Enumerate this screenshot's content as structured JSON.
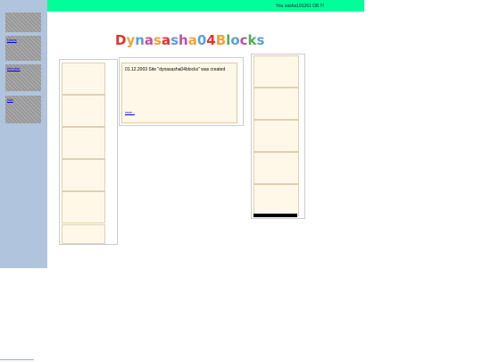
{
  "topbar": {
    "info": "You sasha191261 ОБ !!!"
  },
  "logo": {
    "text": "Dynasasha04Blocks",
    "letter_colors": [
      "#e0332e",
      "#f2a33a",
      "#5aa0d8",
      "#c24fa0",
      "#f2a33a",
      "#e0332e",
      "#5aa0d8",
      "#c24fa0",
      "#f2a33a",
      "#5aa0d8",
      "#e0332e",
      "#f2a33a",
      "#4fb04f",
      "#5aa0d8",
      "#c24fa0",
      "#4fb04f",
      "#5aa0d8"
    ]
  },
  "sidebar": {
    "links": [
      "Home",
      "Member",
      "Info"
    ]
  },
  "news": {
    "text": "01.12.2003 Site \"dynasasha04blocks\" was created",
    "more": "more..."
  },
  "colors": {
    "sidebar": "#b0c4de",
    "topbar": "#00ff99",
    "cell": "#fff8e8"
  }
}
